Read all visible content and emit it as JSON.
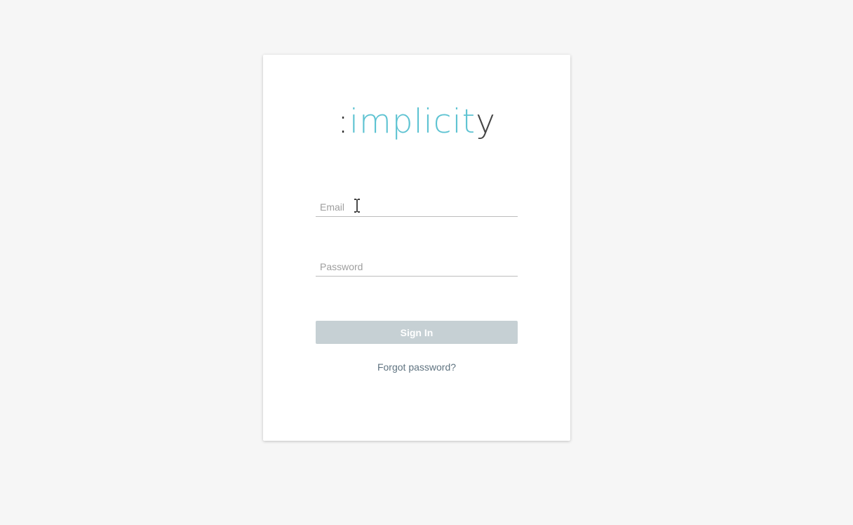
{
  "logo": {
    "prefix": ":",
    "middle": "implicit",
    "suffix": "y",
    "accent_color": "#5ec3d2"
  },
  "form": {
    "email_placeholder": "Email",
    "email_value": "",
    "password_placeholder": "Password",
    "password_value": "",
    "signin_label": "Sign In",
    "forgot_label": "Forgot password?",
    "button_color": "#c6d0d4"
  },
  "icons": {
    "cursor": "text-cursor-icon"
  }
}
